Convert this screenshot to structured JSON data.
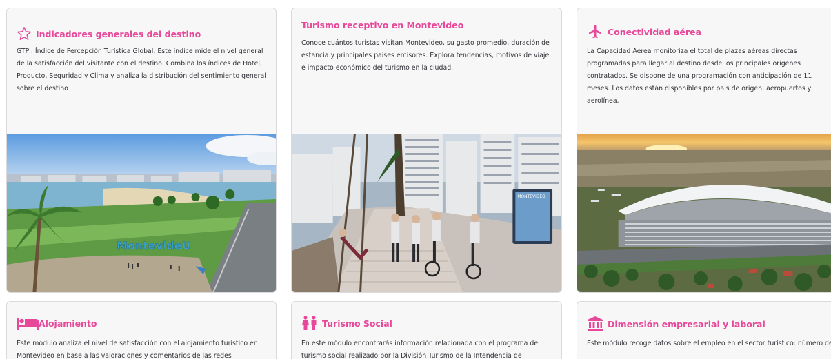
{
  "cards": [
    {
      "title": "Indicadores generales del destino",
      "icon": "star-icon",
      "description": "GTPi: Índice de Percepción Turística Global. Este índice mide el nivel general de la satisfacción del visitante con el destino. Combina los índices de Hotel, Producto, Seguridad y Clima y analiza la distribución del sentimiento general sobre el destino",
      "image_alt": "Montevideo rambla with MontevideU sign"
    },
    {
      "title": "Turismo receptivo en Montevideo",
      "icon": "",
      "description": "Conoce cuántos turistas visitan Montevideo, su gasto promedio, duración de estancia y principales países emisores. Explora tendencias, motivos de viaje e impacto económico del turismo en la ciudad.",
      "image_alt": "People walking and cycling on the rambla",
      "sign_text": "MONTEVIDEO"
    },
    {
      "title": "Conectividad aérea",
      "icon": "airplane-icon",
      "description": "La Capacidad Aérea monitoriza el total de plazas aéreas directas programadas para llegar al destino desde los principales orígenes contratados. Se dispone de una programación con anticipación de 11 meses. Los datos están disponibles por país de origen, aeropuertos y aerolínea.",
      "image_alt": "Aerial view of Carrasco airport terminal at sunset"
    },
    {
      "title": "Alojamiento",
      "icon": "bed-icon",
      "description": "Este módulo analiza el nivel de satisfacción con el alojamiento turístico en Montevideo en base a las valoraciones y comentarios de las redes"
    },
    {
      "title": "Turismo Social",
      "icon": "people-icon",
      "description": "En este módulo encontrarás información relacionada con el programa de turismo social realizado por la División Turismo de la Intendencia de"
    },
    {
      "title": "Dimensión empresarial y laboral",
      "icon": "bank-icon",
      "description": "Este módulo recoge datos sobre el empleo en el sector turístico: número de trabajadores, características del mercado laboral, formación"
    }
  ],
  "colors": {
    "accent": "#e8489a",
    "card_bg": "#f7f7f8",
    "border": "#d9d9de"
  },
  "sign_rambla": "MontevideU"
}
